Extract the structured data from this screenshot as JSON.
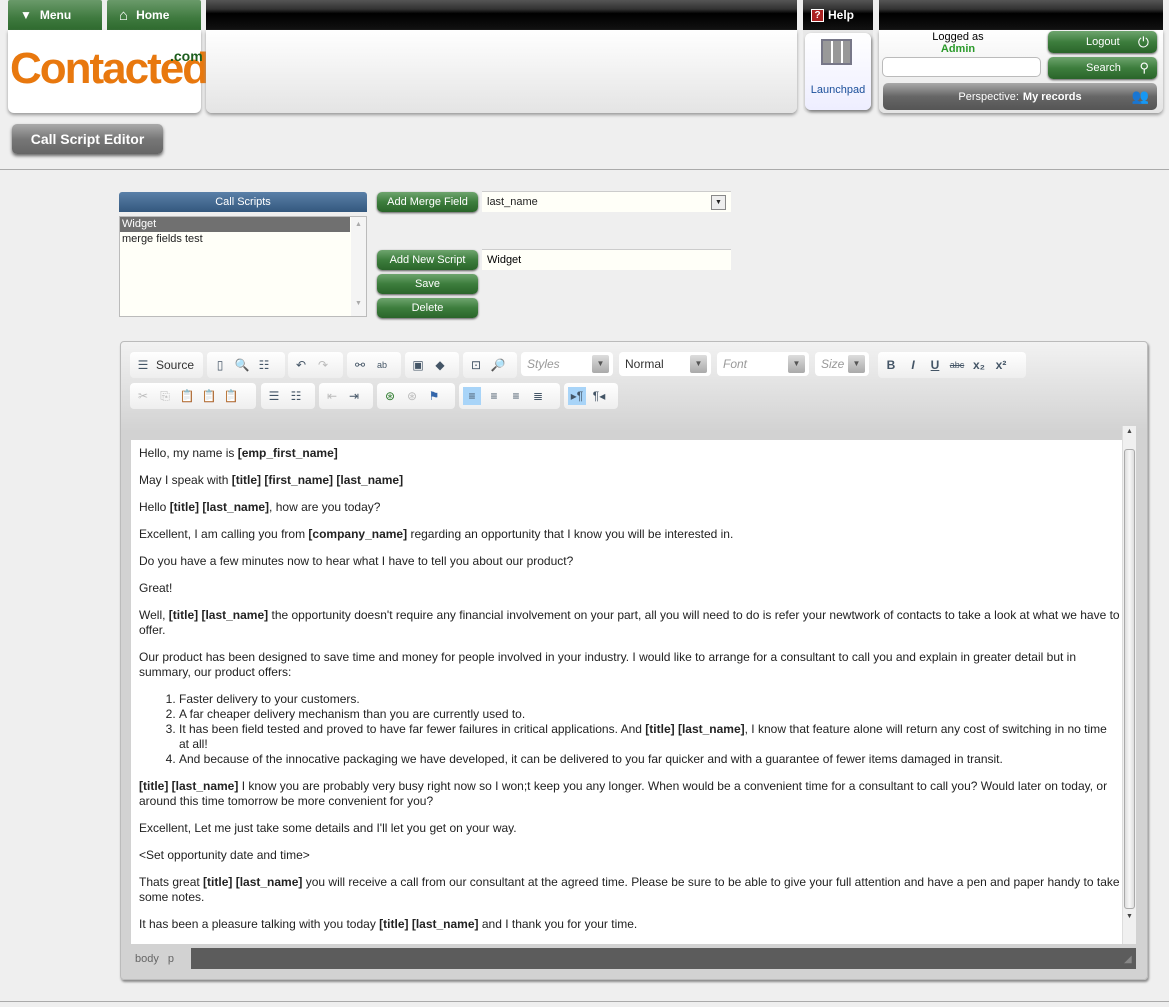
{
  "nav": {
    "menu": "Menu",
    "home": "Home",
    "help": "Help",
    "launchpad": "Launchpad"
  },
  "logo": {
    "text": "Contacted",
    "suffix": ".com"
  },
  "user": {
    "logged_as": "Logged as",
    "name": "Admin",
    "search_value": "",
    "logout": "Logout",
    "search": "Search",
    "perspective_label": "Perspective:",
    "perspective_value": "My records"
  },
  "page": {
    "title": "Call Script Editor"
  },
  "scripts": {
    "header": "Call Scripts",
    "items": [
      "Widget",
      "merge fields test"
    ],
    "selected": 0
  },
  "actions": {
    "add_merge_field": "Add Merge Field",
    "merge_field_value": "last_name",
    "add_new_script": "Add New Script",
    "script_name_value": "Widget",
    "save": "Save",
    "delete": "Delete"
  },
  "toolbar": {
    "source": "Source",
    "styles": "Styles",
    "format": "Normal",
    "font": "Font",
    "size": "Size"
  },
  "statusbar": {
    "path": [
      "body",
      "p"
    ]
  },
  "content": [
    {
      "type": "p",
      "segs": [
        [
          "Hello, my name is ",
          0
        ],
        [
          "[emp_first_name]",
          1
        ]
      ]
    },
    {
      "type": "p",
      "segs": [
        [
          "May I speak with ",
          0
        ],
        [
          "[title] [first_name] [last_name]",
          1
        ]
      ]
    },
    {
      "type": "p",
      "segs": [
        [
          "Hello ",
          0
        ],
        [
          "[title] [last_name]",
          1
        ],
        [
          ", how are you today?",
          0
        ]
      ]
    },
    {
      "type": "p",
      "segs": [
        [
          "Excellent, I am calling you from ",
          0
        ],
        [
          "[company_name]",
          1
        ],
        [
          " regarding an opportunity that I know you will be interested in.",
          0
        ]
      ]
    },
    {
      "type": "p",
      "segs": [
        [
          "Do you have a few minutes now to hear what I have to tell you about our product?",
          0
        ]
      ]
    },
    {
      "type": "p",
      "segs": [
        [
          "Great!",
          0
        ]
      ]
    },
    {
      "type": "p",
      "segs": [
        [
          "Well, ",
          0
        ],
        [
          "[title] [last_name]",
          1
        ],
        [
          " the opportunity doesn't require any financial involvement on your part, all you will need to do is refer your newtwork of contacts to take a look at what we have to offer.",
          0
        ]
      ]
    },
    {
      "type": "p",
      "segs": [
        [
          "Our product has been designed to save time and money for people involved in your industry. I would like to arrange for a consultant to call you and explain in greater detail but in summary, our product offers:",
          0
        ]
      ]
    },
    {
      "type": "ol",
      "items": [
        [
          [
            "Faster delivery to your customers.",
            0
          ]
        ],
        [
          [
            "A far cheaper delivery mechanism than you are currently used to.",
            0
          ]
        ],
        [
          [
            "It has been field tested and proved to have far fewer failures in critical applications. And ",
            0
          ],
          [
            "[title] [last_name]",
            1
          ],
          [
            ", I know that feature alone will return any cost of switching in no time at all!",
            0
          ]
        ],
        [
          [
            "And because of the innocative packaging we have developed, it can be delivered to you far quicker and with a guarantee of fewer items damaged in transit.",
            0
          ]
        ]
      ]
    },
    {
      "type": "p",
      "segs": [
        [
          "[title] [last_name]",
          1
        ],
        [
          "  I know you are probably very busy right now so I won;t keep you any longer. When would be a convenient time for a consultant to call you? Would later on today, or around this time tomorrow be more convenient for you?",
          0
        ]
      ]
    },
    {
      "type": "p",
      "segs": [
        [
          "Excellent, Let me just take some details and I'll let you get on your way.",
          0
        ]
      ]
    },
    {
      "type": "p",
      "segs": [
        [
          "<Set opportunity date and time>",
          0
        ]
      ]
    },
    {
      "type": "p",
      "segs": [
        [
          "Thats great ",
          0
        ],
        [
          "[title] [last_name]",
          1
        ],
        [
          " you will receive a call from our consultant at the agreed time. Please be sure to be able to give your full attention and have a pen and paper handy to take some notes.",
          0
        ]
      ]
    },
    {
      "type": "p",
      "segs": [
        [
          "It has been a pleasure talking with you today ",
          0
        ],
        [
          "[title] [last_name]",
          1
        ],
        [
          " and I thank you for your time.",
          0
        ]
      ]
    }
  ],
  "colors": {
    "brand_orange": "#e8780e",
    "green": "#3d7d3d",
    "admin_green": "#2a9a2a",
    "blue_header": "#3a5f86"
  }
}
